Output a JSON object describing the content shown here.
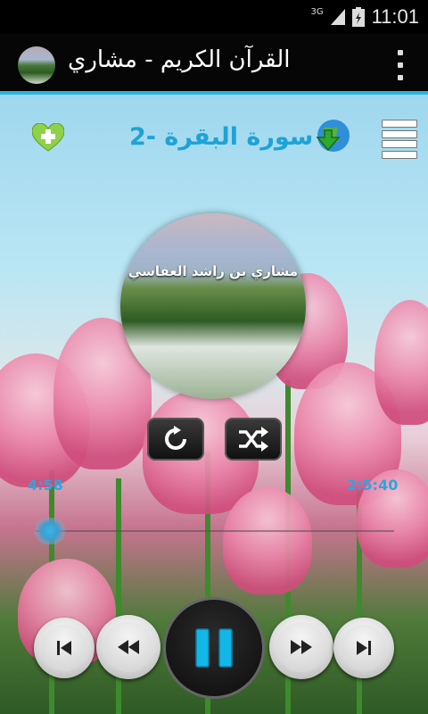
{
  "status_bar": {
    "network": "3G",
    "time": "11:01"
  },
  "app_bar": {
    "title": "القرآن الكريم - مشاري",
    "app_icon": "landscape-thumbnail",
    "overflow_icon": "overflow-menu-icon"
  },
  "player": {
    "surah_title": "2- سورة البقرة",
    "reciter": "مشاري بن راشد العفاسي",
    "elapsed": "4:58",
    "duration": "2:5:40",
    "progress_fraction": 0.04,
    "icons": {
      "favorite": "favorite-add-icon",
      "download": "download-globe-icon",
      "playlist": "playlist-menu-icon",
      "repeat": "repeat-icon",
      "shuffle": "shuffle-icon",
      "skip_previous": "skip-previous-icon",
      "rewind": "rewind-icon",
      "pause": "pause-icon",
      "fast_forward": "fast-forward-icon",
      "skip_next": "skip-next-icon"
    },
    "colors": {
      "accent": "#29b6e6",
      "title_blue": "#1ea3d6",
      "pause_cyan": "#12b7e8"
    }
  }
}
